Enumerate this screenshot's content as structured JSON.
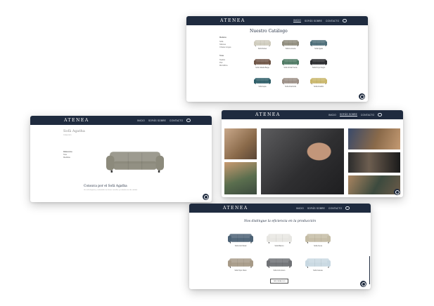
{
  "brand": "ATENEA",
  "colors": {
    "nav": "#1f2b3f",
    "bg": "#ffffff"
  },
  "nav_links": [
    "INICIO",
    "SOFÁS SOBRE",
    "CONTACTO"
  ],
  "icons": [
    "search-icon",
    "whatsapp-icon"
  ],
  "catalog_card": {
    "title": "Nuestro Catálogo",
    "filter_groups": [
      {
        "label": "Modelos",
        "items": [
          "Sofá",
          "Sillones",
          "Chaise longue"
        ]
      },
      {
        "label": "Telas",
        "items": [
          "Tejidos",
          "Piel",
          "Microfibra"
        ]
      }
    ],
    "products": [
      {
        "name": "Sofá Nubes",
        "color": "#cfcbbd"
      },
      {
        "name": "Sofá Lucrecia",
        "color": "#8f8c7d"
      },
      {
        "name": "Sofá Agata",
        "color": "#4c6d78"
      },
      {
        "name": "Sofá Velada Beige",
        "color": "#6e5446"
      },
      {
        "name": "Sofá Cristal Verde",
        "color": "#4f7a64"
      },
      {
        "name": "Sofá Onyx Negro",
        "color": "#2a2b2e"
      },
      {
        "name": "Sofá Aqua",
        "color": "#2e5e68"
      },
      {
        "name": "Sofá Alcachofa",
        "color": "#9c8f86"
      },
      {
        "name": "Sofá Amarillo",
        "color": "#c9b66a"
      }
    ]
  },
  "product_card": {
    "title": "Sofá Agatha",
    "subtitle": "Colección",
    "side_label": "Referencia",
    "side_values": [
      "Tela",
      "Medidas"
    ],
    "heading": "Conozca por el Sofá Agatha",
    "paragraph": "Un sofá elegante y confortable con líneas sencillas y acabados de alta calidad.",
    "sofa_color": "#8c8a7c"
  },
  "photos_card": {
    "photo_colors": [
      "#9c7a5a",
      "#3a3a3a",
      "#6d5e50",
      "#4c4d4f",
      "#8a6a4a",
      "#3c4a3e",
      "#7a5a3c"
    ]
  },
  "production_card": {
    "title": "Nos distingue la eficiencia en la producción",
    "products": [
      {
        "name": "Sofá Azul Metal",
        "color": "#4c6275"
      },
      {
        "name": "Sofá Blanco",
        "color": "#e7e6e2"
      },
      {
        "name": "Sofá Arena",
        "color": "#c4bca5"
      },
      {
        "name": "Sofá Topo Claro",
        "color": "#a79a87"
      },
      {
        "name": "Sofá Gris Acero",
        "color": "#6f7175"
      },
      {
        "name": "Sofá Celeste",
        "color": "#c8d8e2"
      }
    ],
    "button": "VER CATÁLOGO"
  }
}
